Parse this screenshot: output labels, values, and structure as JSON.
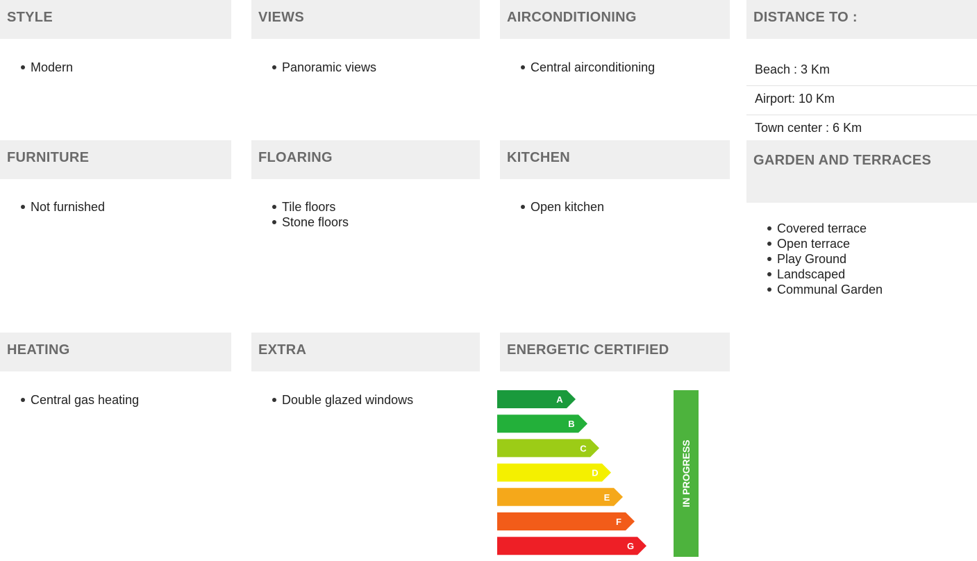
{
  "sections": {
    "style": {
      "title": "STYLE",
      "items": [
        "Modern"
      ]
    },
    "views": {
      "title": "VIEWS",
      "items": [
        "Panoramic views"
      ]
    },
    "aircon": {
      "title": "AIRCONDITIONING",
      "items": [
        "Central airconditioning"
      ]
    },
    "distance": {
      "title": "DISTANCE TO :",
      "items": [
        "Beach : 3 Km",
        "Airport: 10 Km",
        "Town center : 6 Km"
      ]
    },
    "furniture": {
      "title": "FURNITURE",
      "items": [
        "Not furnished"
      ]
    },
    "flooring": {
      "title": "FLOARING",
      "items": [
        "Tile floors",
        "Stone floors"
      ]
    },
    "kitchen": {
      "title": "KITCHEN",
      "items": [
        "Open kitchen"
      ]
    },
    "garden": {
      "title": "GARDEN AND TERRACES",
      "items": [
        "Covered terrace",
        "Open terrace",
        "Play Ground",
        "Landscaped",
        "Communal Garden"
      ]
    },
    "heating": {
      "title": "HEATING",
      "items": [
        "Central gas heating"
      ]
    },
    "extra": {
      "title": "EXTRA",
      "items": [
        "Double glazed windows"
      ]
    },
    "energy": {
      "title": "ENERGETIC CERTIFIED"
    }
  },
  "energy_label": {
    "classes": [
      {
        "letter": "A",
        "color": "#1a9a3c"
      },
      {
        "letter": "B",
        "color": "#23b03a"
      },
      {
        "letter": "C",
        "color": "#9ccc16"
      },
      {
        "letter": "D",
        "color": "#f4f000"
      },
      {
        "letter": "E",
        "color": "#f5a81a"
      },
      {
        "letter": "F",
        "color": "#f25c19"
      },
      {
        "letter": "G",
        "color": "#ee1f26"
      }
    ],
    "status": "IN PROGRESS",
    "status_color": "#4db33d"
  }
}
